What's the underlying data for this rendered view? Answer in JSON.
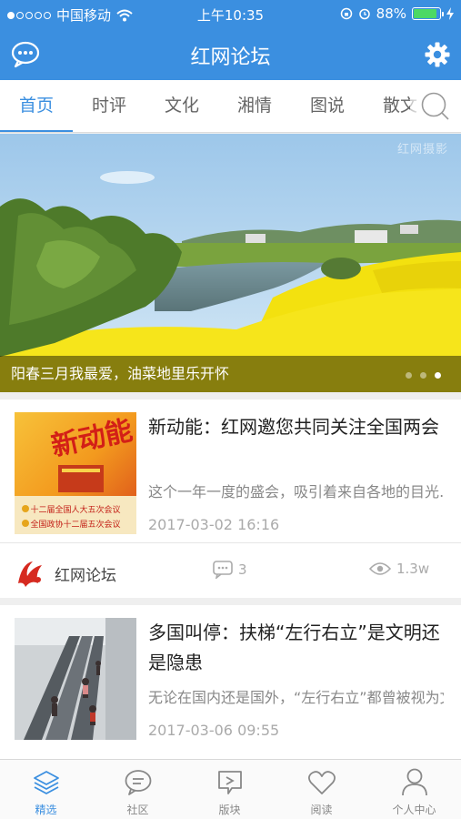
{
  "status_bar": {
    "carrier": "中国移动",
    "time": "上午10:35",
    "battery": "88%",
    "battery_level": 0.88
  },
  "header": {
    "title": "红网论坛",
    "chat_icon": "chat-bubble-icon",
    "settings_icon": "gear-icon"
  },
  "tabs": [
    {
      "label": "首页",
      "active": true
    },
    {
      "label": "时评",
      "active": false
    },
    {
      "label": "文化",
      "active": false
    },
    {
      "label": "湘情",
      "active": false
    },
    {
      "label": "图说",
      "active": false
    },
    {
      "label": "散文",
      "active": false
    }
  ],
  "banner": {
    "caption": "阳春三月我最爱，油菜地里乐开怀",
    "watermark": "红网摄影",
    "slide_count": 3,
    "active_slide": 3
  },
  "articles": [
    {
      "title": "新动能：红网邀您共同关注全国两会",
      "summary": "这个一年一度的盛会，吸引着来自各地的目光……",
      "time": "2017-03-02 16:16",
      "source": "红网论坛",
      "comments": "3",
      "views": "1.3w",
      "thumb_text": {
        "main": "新动能",
        "line1": "十二届全国人大五次会议",
        "line2": "全国政协十二届五次会议"
      }
    },
    {
      "title": "多国叫停：扶梯“左行右立”是文明还是隐患",
      "summary": "无论在国内还是国外，“左行右立”都曾被视为文明……",
      "time": "2017-03-06 09:55"
    }
  ],
  "bottom_nav": [
    {
      "label": "精选",
      "icon": "layers-icon",
      "active": true
    },
    {
      "label": "社区",
      "icon": "chat-icon",
      "active": false
    },
    {
      "label": "版块",
      "icon": "board-icon",
      "active": false
    },
    {
      "label": "阅读",
      "icon": "heart-icon",
      "active": false
    },
    {
      "label": "个人中心",
      "icon": "person-icon",
      "active": false
    }
  ],
  "colors": {
    "accent": "#3b8fe0",
    "battery_fill": "#4cd964"
  }
}
